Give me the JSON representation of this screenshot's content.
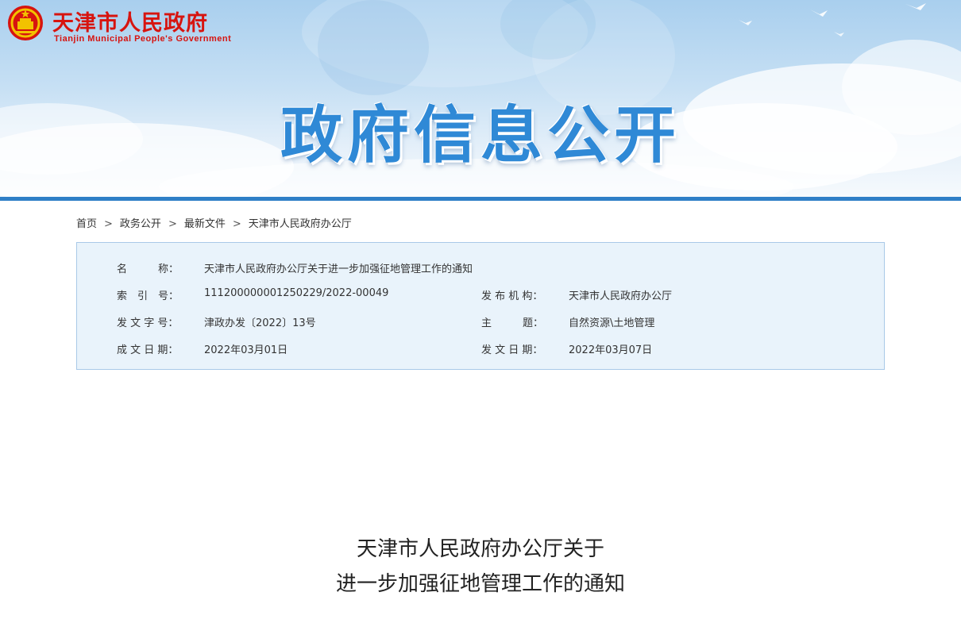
{
  "header": {
    "site_name_cn": "天津市人民政府",
    "site_name_en": "Tianjin Municipal People's Government",
    "banner_title": "政府信息公开",
    "emblem_icon": "national-emblem-icon"
  },
  "breadcrumb": {
    "items": [
      "首页",
      "政务公开",
      "最新文件",
      "天津市人民政府办公厅"
    ],
    "separator": ">"
  },
  "meta": {
    "name_label": "名　　　称：",
    "name_value": "天津市人民政府办公厅关于进一步加强征地管理工作的通知",
    "index_label": "索　引　号：",
    "index_value": "111200000001250229/2022-00049",
    "issuer_label": "发 布 机 构：",
    "issuer_value": "天津市人民政府办公厅",
    "docno_label": "发 文 字 号：",
    "docno_value": "津政办发〔2022〕13号",
    "subject_label": "主　　　题：",
    "subject_value": "自然资源\\土地管理",
    "written_label": "成 文 日 期：",
    "written_value": "2022年03月01日",
    "published_label": "发 文 日 期：",
    "published_value": "2022年03月07日"
  },
  "document": {
    "title_line1": "天津市人民政府办公厅关于",
    "title_line2": "进一步加强征地管理工作的通知"
  },
  "colors": {
    "brand_red": "#d7140f",
    "banner_blue": "#2f89d6",
    "divider_blue": "#2f7fc7",
    "meta_bg": "#e9f3fb",
    "meta_border": "#a9c9e8"
  }
}
